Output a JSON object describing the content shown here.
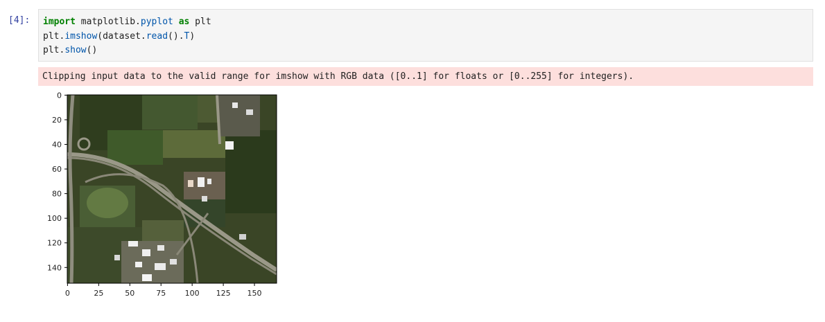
{
  "cell": {
    "prompt": "[4]:",
    "code_lines": [
      {
        "tokens": [
          {
            "t": "import",
            "c": "kw"
          },
          {
            "t": " matplotlib.",
            "c": ""
          },
          {
            "t": "pyplot",
            "c": "nm"
          },
          {
            "t": " ",
            "c": ""
          },
          {
            "t": "as",
            "c": "kw"
          },
          {
            "t": " plt",
            "c": ""
          }
        ]
      },
      {
        "tokens": [
          {
            "t": "plt.",
            "c": ""
          },
          {
            "t": "imshow",
            "c": "nm"
          },
          {
            "t": "(dataset.",
            "c": ""
          },
          {
            "t": "read",
            "c": "nm"
          },
          {
            "t": "().",
            "c": ""
          },
          {
            "t": "T",
            "c": "nm"
          },
          {
            "t": ")",
            "c": ""
          }
        ]
      },
      {
        "tokens": [
          {
            "t": "plt.",
            "c": ""
          },
          {
            "t": "show",
            "c": "nm"
          },
          {
            "t": "()",
            "c": ""
          }
        ]
      }
    ]
  },
  "output": {
    "warning": "Clipping input data to the valid range for imshow with RGB data ([0..1] for floats or [0..255] for integers)."
  },
  "image_plot": {
    "y_ticks": [
      "0",
      "20",
      "40",
      "60",
      "80",
      "100",
      "120",
      "140"
    ],
    "x_ticks": [
      "0",
      "25",
      "50",
      "75",
      "100",
      "125",
      "150"
    ],
    "image_description_colors": {
      "vegetation_dark": "#2e3a1f",
      "vegetation": "#3f5028",
      "field": "#5a6e35",
      "road": "#8a8a7a",
      "building": "#e8e8e8"
    }
  }
}
